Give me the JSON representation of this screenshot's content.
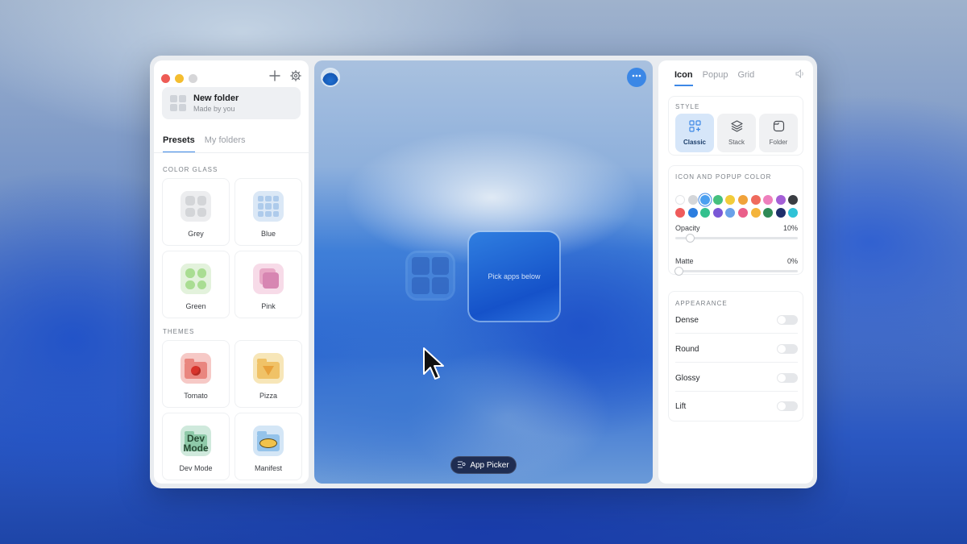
{
  "left_panel": {
    "folder": {
      "name": "New folder",
      "subtitle": "Made by you"
    },
    "tabs": [
      {
        "label": "Presets",
        "active": true
      },
      {
        "label": "My folders",
        "active": false
      }
    ],
    "color_glass_label": "COLOR GLASS",
    "color_glass": [
      {
        "label": "Grey",
        "icon": "grey-grid-icon"
      },
      {
        "label": "Blue",
        "icon": "blue-grid-icon"
      },
      {
        "label": "Green",
        "icon": "green-dots-icon"
      },
      {
        "label": "Pink",
        "icon": "pink-stack-icon"
      }
    ],
    "themes_label": "THEMES",
    "themes": [
      {
        "label": "Tomato",
        "icon": "tomato-folder-icon"
      },
      {
        "label": "Pizza",
        "icon": "pizza-folder-icon"
      },
      {
        "label": "Dev Mode",
        "icon": "dev-folder-icon",
        "badge_text": "Dev Mode"
      },
      {
        "label": "Manifest",
        "icon": "manifest-folder-icon"
      }
    ]
  },
  "canvas": {
    "tile_text": "Pick apps below",
    "app_picker_label": "App Picker"
  },
  "right_panel": {
    "tabs": [
      {
        "label": "Icon",
        "active": true
      },
      {
        "label": "Popup",
        "active": false
      },
      {
        "label": "Grid",
        "active": false
      }
    ],
    "style_label": "STYLE",
    "styles": [
      {
        "label": "Classic",
        "icon": "classic-icon",
        "active": true
      },
      {
        "label": "Stack",
        "icon": "stack-icon",
        "active": false
      },
      {
        "label": "Folder",
        "icon": "folder-icon",
        "active": false
      }
    ],
    "color_label": "ICON AND POPUP COLOR",
    "swatches": [
      "#ffffff",
      "#d4d6d9",
      "#4a9ff0",
      "#45c07e",
      "#f2cc3a",
      "#f0a23a",
      "#ef6a5d",
      "#ee7fbd",
      "#a45fd6",
      "#3a3d42",
      "#ef5b5b",
      "#2c7ee0",
      "#34c08e",
      "#7a57d6",
      "#6aa1e8",
      "#ea5f8a",
      "#f4b43b",
      "#2f8a56",
      "#1f2f6b",
      "#2fc2d6"
    ],
    "selected_swatch": 2,
    "opacity": {
      "label": "Opacity",
      "value": "10%",
      "level": 0.1
    },
    "matte": {
      "label": "Matte",
      "value": "0%",
      "level": 0
    },
    "appearance_label": "APPEARANCE",
    "appearance": [
      {
        "label": "Dense",
        "on": false
      },
      {
        "label": "Round",
        "on": false
      },
      {
        "label": "Glossy",
        "on": false
      },
      {
        "label": "Lift",
        "on": false
      }
    ]
  }
}
